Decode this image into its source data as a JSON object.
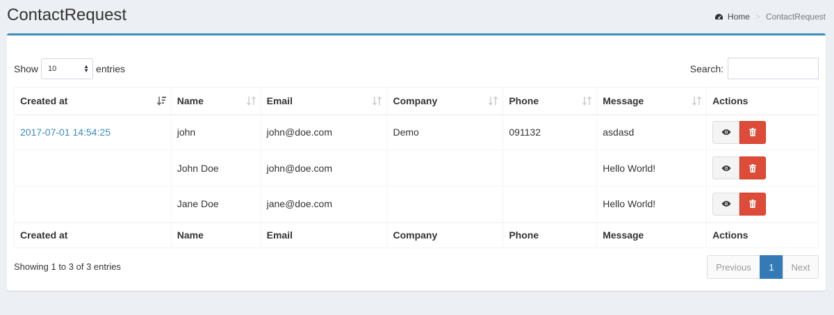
{
  "header": {
    "title": "ContactRequest",
    "breadcrumb": {
      "home": "Home",
      "separator": ">",
      "current": "ContactRequest"
    }
  },
  "controls": {
    "show_label": "Show",
    "length_value": "10",
    "entries_label": "entries",
    "search_label": "Search:",
    "search_value": ""
  },
  "table": {
    "columns": [
      "Created at",
      "Name",
      "Email",
      "Company",
      "Phone",
      "Message",
      "Actions"
    ],
    "rows": [
      {
        "created_at": "2017-07-01 14:54:25",
        "name": "john",
        "email": "john@doe.com",
        "company": "Demo",
        "phone": "091132",
        "message": "asdasd"
      },
      {
        "created_at": "",
        "name": "John Doe",
        "email": "john@doe.com",
        "company": "",
        "phone": "",
        "message": "Hello World!"
      },
      {
        "created_at": "",
        "name": "Jane Doe",
        "email": "jane@doe.com",
        "company": "",
        "phone": "",
        "message": "Hello World!"
      }
    ],
    "sort_column": "Created at",
    "sort_direction": "desc"
  },
  "footer": {
    "info": "Showing 1 to 3 of 3 entries",
    "pagination": {
      "previous": "Previous",
      "current": "1",
      "next": "Next"
    }
  },
  "icons": {
    "breadcrumb": "dashboard-icon",
    "view": "eye-icon",
    "delete": "trash-icon",
    "sort": "sort-icon"
  },
  "colors": {
    "accent": "#3c8dbc",
    "danger": "#dd4b39",
    "page_active": "#337ab7",
    "background": "#ecf0f5"
  }
}
